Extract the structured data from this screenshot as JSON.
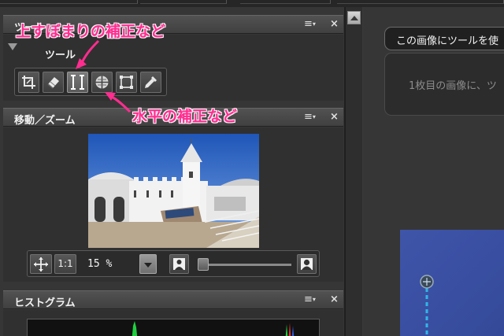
{
  "palette": {
    "tools_panel": {
      "title": "ツール",
      "group_label": "ツール",
      "tools": [
        {
          "icon": "crop-icon",
          "active": false
        },
        {
          "icon": "eraser-icon",
          "active": false
        },
        {
          "icon": "vertical-correction-icon",
          "active": true
        },
        {
          "icon": "horizontal-correction-icon",
          "active": false
        },
        {
          "icon": "transform-icon",
          "active": false
        },
        {
          "icon": "eyedropper-icon",
          "active": false
        }
      ]
    },
    "navigator_panel": {
      "title": "移動／ズーム",
      "actual_size_label": "1:1",
      "zoom_value": "15 %",
      "zoom_slider_level": 0.0
    },
    "histogram_panel": {
      "title": "ヒストグラム"
    },
    "menu_glyph": "≡",
    "close_glyph": "×"
  },
  "hint": {
    "tab_text": "この画像にツールを使",
    "body_text": "1枚目の画像に、ツ"
  },
  "annotations": {
    "top": "上すぼまりの補正など",
    "middle": "水平の補正など",
    "color": "#ff2d8f"
  },
  "colors": {
    "panel_bg": "#303030",
    "header_bg": "#4a4a4a",
    "annotation": "#ff2d8f",
    "guide_line": "#2fb8e8"
  }
}
